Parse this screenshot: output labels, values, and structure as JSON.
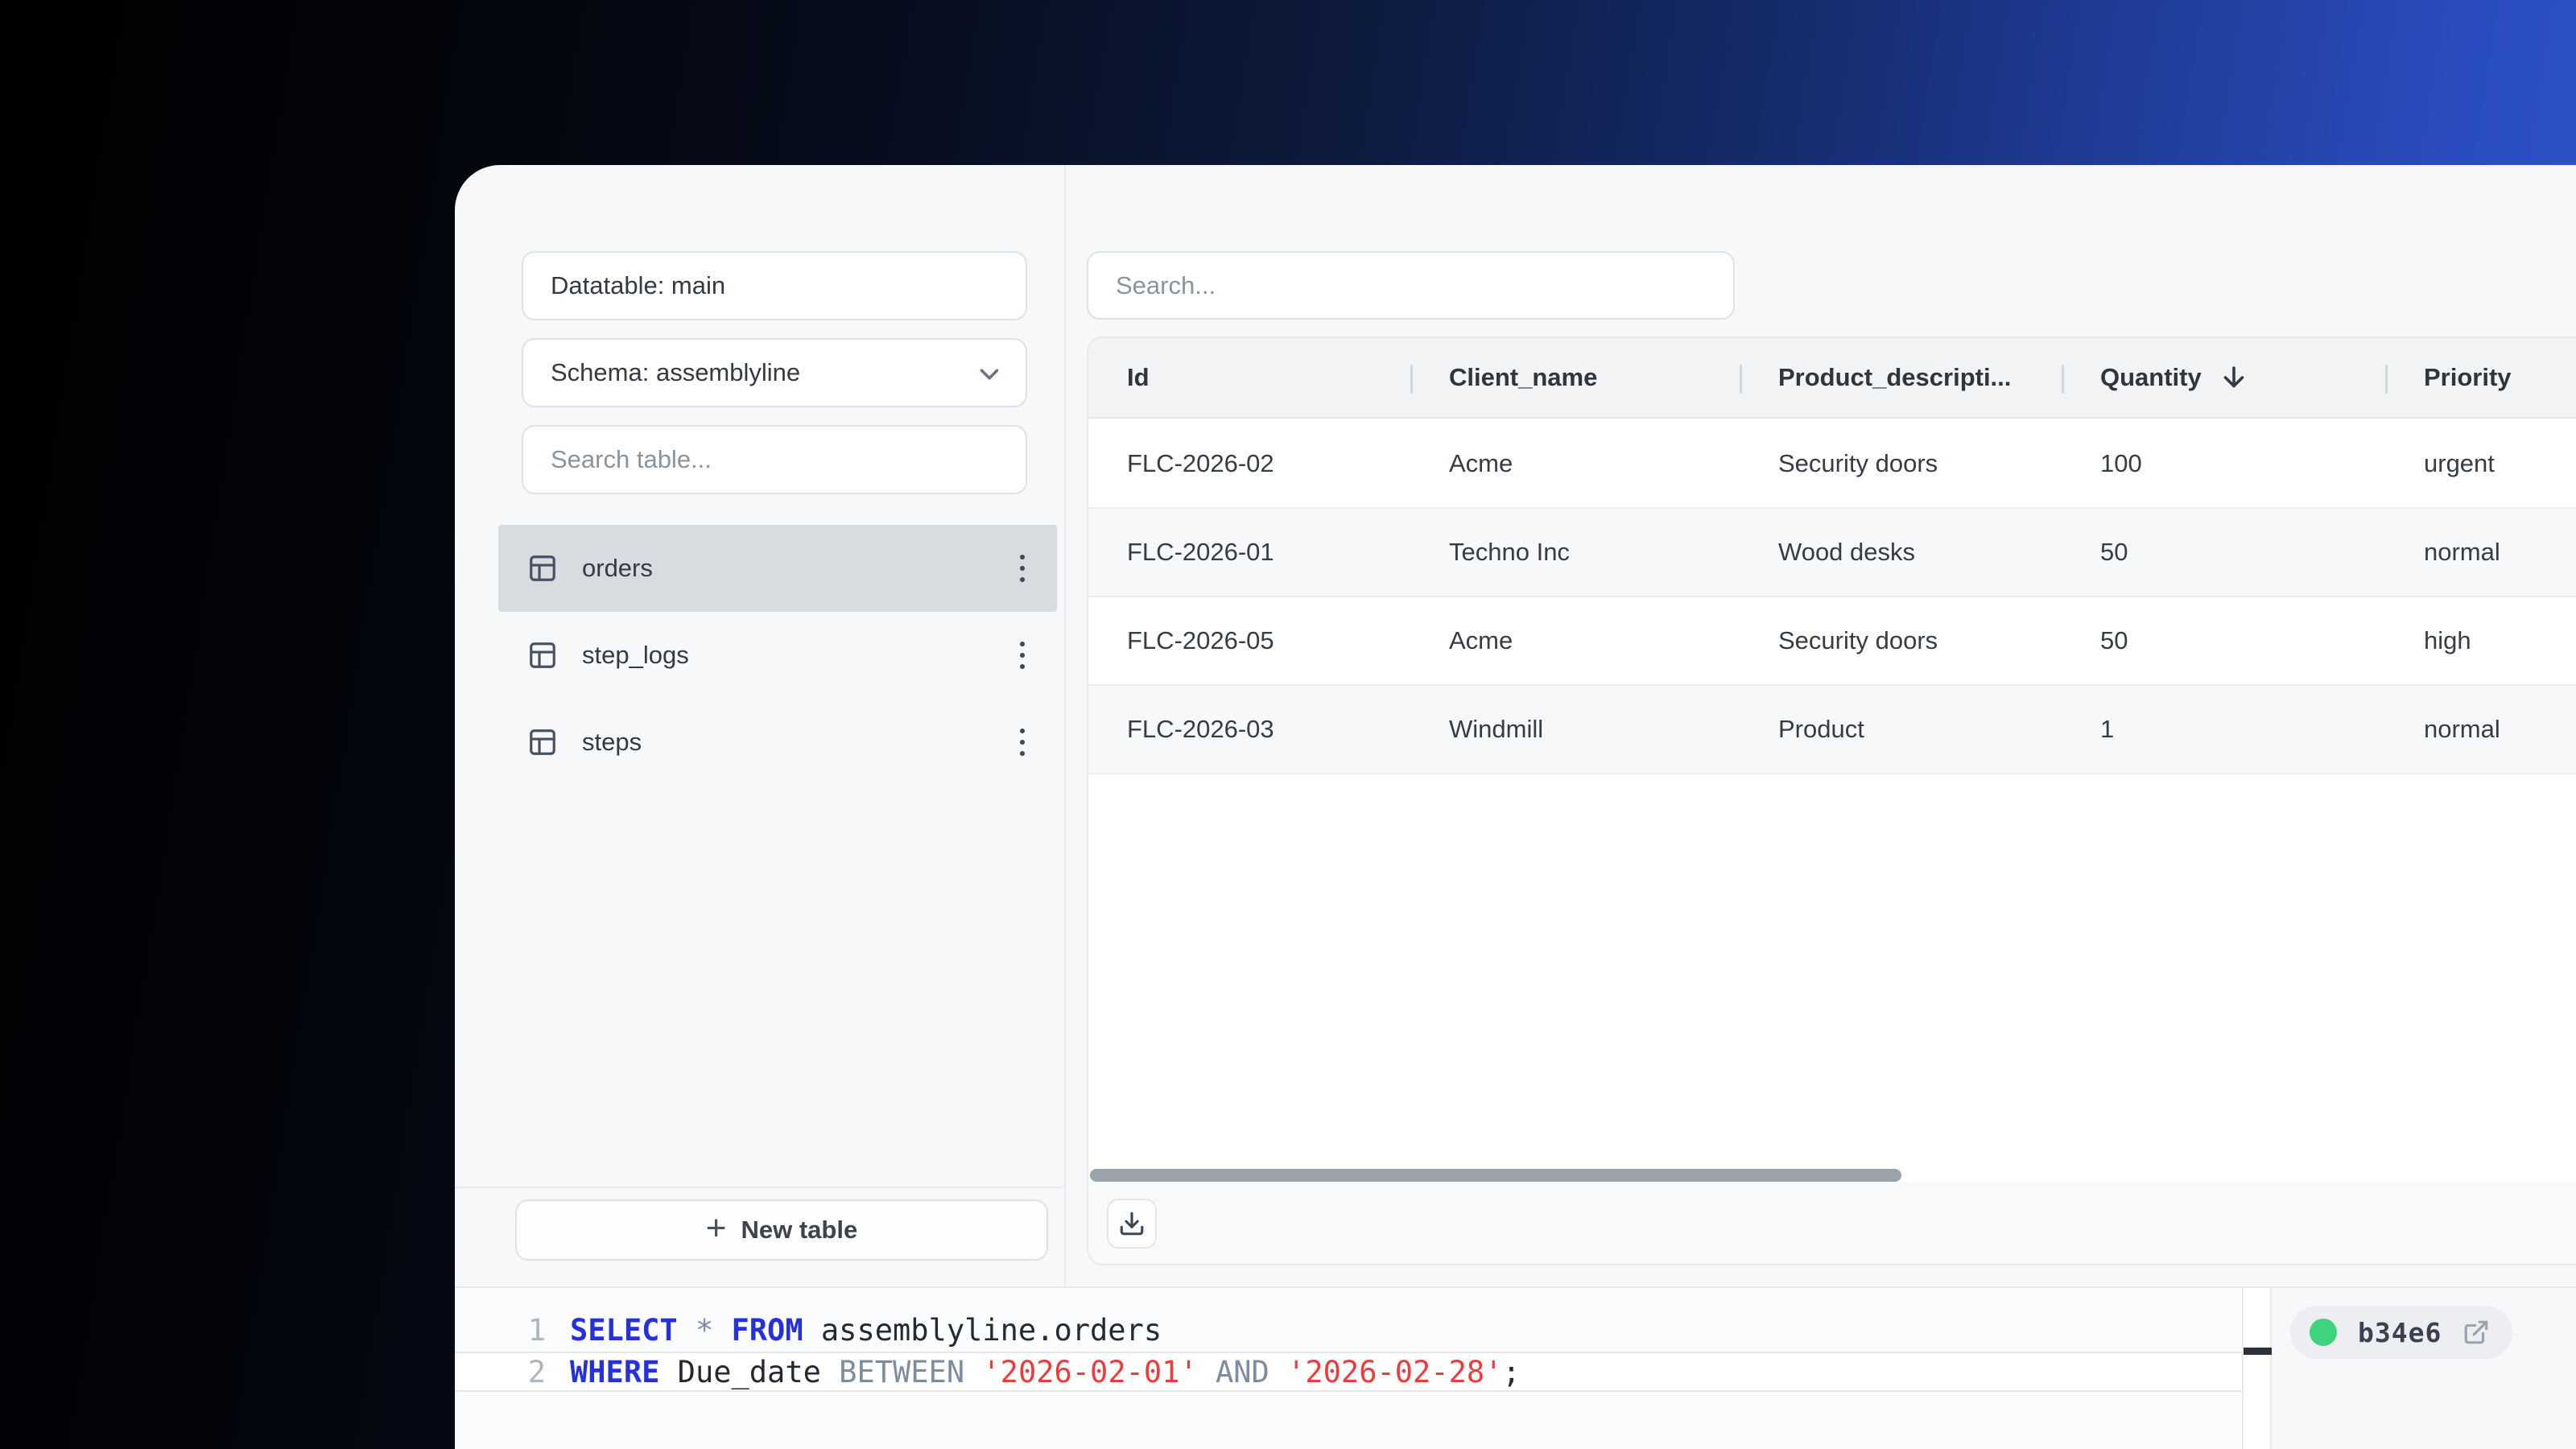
{
  "colors": {
    "accent_blue": "#2a4cbd",
    "keyword_blue": "#2531dd",
    "string_red": "#ee3b3b",
    "status_green": "#3ed47e",
    "selected_gray": "#d8dbdf"
  },
  "icons": {
    "table": "table-icon",
    "kebab": "kebab-menu-icon",
    "chevron_down": "chevron-down-icon",
    "plus": "+",
    "sort_desc": "arrow-down-icon",
    "download": "download-icon",
    "external_link": "external-link-icon",
    "status_dot": "status-dot"
  },
  "sidebar": {
    "datatable_label": "Datatable: main",
    "schema_label": "Schema: assemblyline",
    "search_placeholder": "Search table...",
    "tables": [
      {
        "name": "orders",
        "selected": true
      },
      {
        "name": "step_logs",
        "selected": false
      },
      {
        "name": "steps",
        "selected": false
      }
    ],
    "new_table_label": "New table"
  },
  "main": {
    "search_placeholder": "Search...",
    "table": {
      "columns": [
        {
          "label": "Id",
          "sort": null
        },
        {
          "label": "Client_name",
          "sort": null
        },
        {
          "label": "Product_descripti...",
          "sort": null
        },
        {
          "label": "Quantity",
          "sort": "desc"
        },
        {
          "label": "Priority",
          "sort": null
        }
      ],
      "rows": [
        [
          "FLC-2026-02",
          "Acme",
          "Security doors",
          "100",
          "urgent"
        ],
        [
          "FLC-2026-01",
          "Techno Inc",
          "Wood desks",
          "50",
          "normal"
        ],
        [
          "FLC-2026-05",
          "Acme",
          "Security doors",
          "50",
          "high"
        ],
        [
          "FLC-2026-03",
          "Windmill",
          "Product",
          "1",
          "normal"
        ]
      ]
    }
  },
  "editor": {
    "lines": [
      {
        "number": "1",
        "tokens": [
          {
            "t": "SELECT",
            "c": "kw"
          },
          {
            "t": " ",
            "c": "id"
          },
          {
            "t": "*",
            "c": "op"
          },
          {
            "t": " ",
            "c": "id"
          },
          {
            "t": "FROM",
            "c": "kw"
          },
          {
            "t": " ",
            "c": "id"
          },
          {
            "t": "assemblyline.orders",
            "c": "id"
          }
        ],
        "active": false
      },
      {
        "number": "2",
        "tokens": [
          {
            "t": "WHERE",
            "c": "kw"
          },
          {
            "t": " ",
            "c": "id"
          },
          {
            "t": "Due_date",
            "c": "id"
          },
          {
            "t": " ",
            "c": "id"
          },
          {
            "t": "BETWEEN",
            "c": "op"
          },
          {
            "t": " ",
            "c": "id"
          },
          {
            "t": "'2026-02-01'",
            "c": "str"
          },
          {
            "t": " ",
            "c": "id"
          },
          {
            "t": "AND",
            "c": "op"
          },
          {
            "t": " ",
            "c": "id"
          },
          {
            "t": "'2026-02-28'",
            "c": "str"
          },
          {
            "t": ";",
            "c": "id"
          }
        ],
        "active": true
      }
    ],
    "badge_label": "b34e6"
  }
}
